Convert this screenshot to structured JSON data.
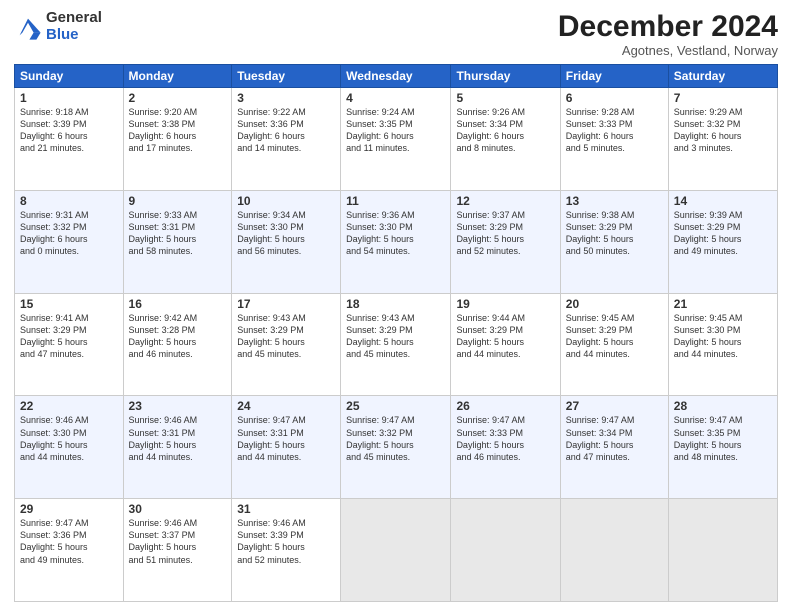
{
  "header": {
    "logo_general": "General",
    "logo_blue": "Blue",
    "month_title": "December 2024",
    "subtitle": "Agotnes, Vestland, Norway"
  },
  "weekdays": [
    "Sunday",
    "Monday",
    "Tuesday",
    "Wednesday",
    "Thursday",
    "Friday",
    "Saturday"
  ],
  "weeks": [
    [
      {
        "day": "1",
        "lines": [
          "Sunrise: 9:18 AM",
          "Sunset: 3:39 PM",
          "Daylight: 6 hours",
          "and 21 minutes."
        ]
      },
      {
        "day": "2",
        "lines": [
          "Sunrise: 9:20 AM",
          "Sunset: 3:38 PM",
          "Daylight: 6 hours",
          "and 17 minutes."
        ]
      },
      {
        "day": "3",
        "lines": [
          "Sunrise: 9:22 AM",
          "Sunset: 3:36 PM",
          "Daylight: 6 hours",
          "and 14 minutes."
        ]
      },
      {
        "day": "4",
        "lines": [
          "Sunrise: 9:24 AM",
          "Sunset: 3:35 PM",
          "Daylight: 6 hours",
          "and 11 minutes."
        ]
      },
      {
        "day": "5",
        "lines": [
          "Sunrise: 9:26 AM",
          "Sunset: 3:34 PM",
          "Daylight: 6 hours",
          "and 8 minutes."
        ]
      },
      {
        "day": "6",
        "lines": [
          "Sunrise: 9:28 AM",
          "Sunset: 3:33 PM",
          "Daylight: 6 hours",
          "and 5 minutes."
        ]
      },
      {
        "day": "7",
        "lines": [
          "Sunrise: 9:29 AM",
          "Sunset: 3:32 PM",
          "Daylight: 6 hours",
          "and 3 minutes."
        ]
      }
    ],
    [
      {
        "day": "8",
        "lines": [
          "Sunrise: 9:31 AM",
          "Sunset: 3:32 PM",
          "Daylight: 6 hours",
          "and 0 minutes."
        ]
      },
      {
        "day": "9",
        "lines": [
          "Sunrise: 9:33 AM",
          "Sunset: 3:31 PM",
          "Daylight: 5 hours",
          "and 58 minutes."
        ]
      },
      {
        "day": "10",
        "lines": [
          "Sunrise: 9:34 AM",
          "Sunset: 3:30 PM",
          "Daylight: 5 hours",
          "and 56 minutes."
        ]
      },
      {
        "day": "11",
        "lines": [
          "Sunrise: 9:36 AM",
          "Sunset: 3:30 PM",
          "Daylight: 5 hours",
          "and 54 minutes."
        ]
      },
      {
        "day": "12",
        "lines": [
          "Sunrise: 9:37 AM",
          "Sunset: 3:29 PM",
          "Daylight: 5 hours",
          "and 52 minutes."
        ]
      },
      {
        "day": "13",
        "lines": [
          "Sunrise: 9:38 AM",
          "Sunset: 3:29 PM",
          "Daylight: 5 hours",
          "and 50 minutes."
        ]
      },
      {
        "day": "14",
        "lines": [
          "Sunrise: 9:39 AM",
          "Sunset: 3:29 PM",
          "Daylight: 5 hours",
          "and 49 minutes."
        ]
      }
    ],
    [
      {
        "day": "15",
        "lines": [
          "Sunrise: 9:41 AM",
          "Sunset: 3:29 PM",
          "Daylight: 5 hours",
          "and 47 minutes."
        ]
      },
      {
        "day": "16",
        "lines": [
          "Sunrise: 9:42 AM",
          "Sunset: 3:28 PM",
          "Daylight: 5 hours",
          "and 46 minutes."
        ]
      },
      {
        "day": "17",
        "lines": [
          "Sunrise: 9:43 AM",
          "Sunset: 3:29 PM",
          "Daylight: 5 hours",
          "and 45 minutes."
        ]
      },
      {
        "day": "18",
        "lines": [
          "Sunrise: 9:43 AM",
          "Sunset: 3:29 PM",
          "Daylight: 5 hours",
          "and 45 minutes."
        ]
      },
      {
        "day": "19",
        "lines": [
          "Sunrise: 9:44 AM",
          "Sunset: 3:29 PM",
          "Daylight: 5 hours",
          "and 44 minutes."
        ]
      },
      {
        "day": "20",
        "lines": [
          "Sunrise: 9:45 AM",
          "Sunset: 3:29 PM",
          "Daylight: 5 hours",
          "and 44 minutes."
        ]
      },
      {
        "day": "21",
        "lines": [
          "Sunrise: 9:45 AM",
          "Sunset: 3:30 PM",
          "Daylight: 5 hours",
          "and 44 minutes."
        ]
      }
    ],
    [
      {
        "day": "22",
        "lines": [
          "Sunrise: 9:46 AM",
          "Sunset: 3:30 PM",
          "Daylight: 5 hours",
          "and 44 minutes."
        ]
      },
      {
        "day": "23",
        "lines": [
          "Sunrise: 9:46 AM",
          "Sunset: 3:31 PM",
          "Daylight: 5 hours",
          "and 44 minutes."
        ]
      },
      {
        "day": "24",
        "lines": [
          "Sunrise: 9:47 AM",
          "Sunset: 3:31 PM",
          "Daylight: 5 hours",
          "and 44 minutes."
        ]
      },
      {
        "day": "25",
        "lines": [
          "Sunrise: 9:47 AM",
          "Sunset: 3:32 PM",
          "Daylight: 5 hours",
          "and 45 minutes."
        ]
      },
      {
        "day": "26",
        "lines": [
          "Sunrise: 9:47 AM",
          "Sunset: 3:33 PM",
          "Daylight: 5 hours",
          "and 46 minutes."
        ]
      },
      {
        "day": "27",
        "lines": [
          "Sunrise: 9:47 AM",
          "Sunset: 3:34 PM",
          "Daylight: 5 hours",
          "and 47 minutes."
        ]
      },
      {
        "day": "28",
        "lines": [
          "Sunrise: 9:47 AM",
          "Sunset: 3:35 PM",
          "Daylight: 5 hours",
          "and 48 minutes."
        ]
      }
    ],
    [
      {
        "day": "29",
        "lines": [
          "Sunrise: 9:47 AM",
          "Sunset: 3:36 PM",
          "Daylight: 5 hours",
          "and 49 minutes."
        ]
      },
      {
        "day": "30",
        "lines": [
          "Sunrise: 9:46 AM",
          "Sunset: 3:37 PM",
          "Daylight: 5 hours",
          "and 51 minutes."
        ]
      },
      {
        "day": "31",
        "lines": [
          "Sunrise: 9:46 AM",
          "Sunset: 3:39 PM",
          "Daylight: 5 hours",
          "and 52 minutes."
        ]
      },
      null,
      null,
      null,
      null
    ]
  ]
}
